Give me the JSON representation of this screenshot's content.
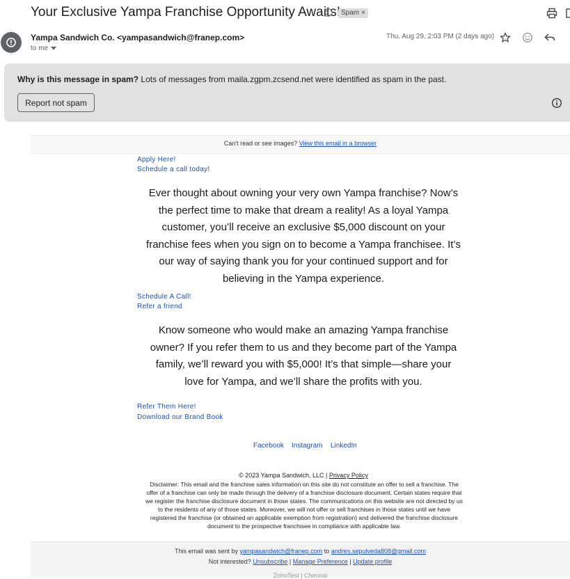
{
  "header": {
    "subject": "Your Exclusive Yampa Franchise Opportunity Awaits!",
    "label_chip": "Spam",
    "sender": "Yampa Sandwich Co. <yampasandwich@franep.com>",
    "recipient": "to me",
    "date": "Thu, Aug 29, 2:03 PM (2 days ago)"
  },
  "banner": {
    "question": "Why is this message in spam?",
    "reason": "Lots of messages from maila.zgpm.zcsend.net were identified as spam in the past.",
    "button": "Report not spam"
  },
  "email": {
    "topbar_text": "Can't read or see images?",
    "topbar_link": "View this email in a browser",
    "link_apply": "Apply Here!",
    "link_schedule_today": "Schedule a call today!",
    "paragraph1": "Ever thought about owning your very own Yampa franchise? Now’s the perfect time to make that dream a reality! As a loyal Yampa customer, you’ll receive an exclusive $5,000 discount on your franchise fees when you sign on to become a Yampa franchisee. It’s our way of saying thank you for your continued support and for believing in the Yampa experience.",
    "link_schedule_call": "Schedule A Call!",
    "link_refer_friend": "Refer a friend",
    "paragraph2": "Know someone who would make an amazing Yampa franchise owner? If you refer them to us and they become part of the Yampa family, we’ll reward you with $5,000! It’s that simple—share your love for Yampa, and we’ll share the profits with you.",
    "link_refer_them": "Refer Them Here!",
    "link_brand_book": "Download our Brand Book",
    "social": [
      "Facebook",
      "Instagram",
      "LinkedIn"
    ],
    "copyright": "© 2023 Yampa Sandwich, LLC |",
    "privacy": "Privacy Policy",
    "disclaimer": "Disclaimer: This email and the franchise sales information on this site do not constitute an offer to sell a franchise. The offer of a franchise can only be made through the delivery of a franchise disclosure document. Certain states require that we register the franchise disclosure document in those states. The communications on this website are not directed by us to the residents of any of those states. Moreover, we will not offer or sell franchises in those states until we have registered the franchise (or obtained an applicable exemption from registration) and delivered the franchise disclosure document to the prospective franchisee in compliance with applicable law."
  },
  "footer": {
    "sent_prefix": "This email was sent by",
    "sent_from": "yampasandwich@franep.com",
    "sent_to_word": "to",
    "sent_to": "andres.sepulveda808@gmail.com",
    "not_interested": "Not interested?",
    "unsubscribe": "Unsubscribe",
    "manage": "Manage Preference",
    "update": "Update profile",
    "sep": "|",
    "brand": "ZohoTest | Chennai"
  }
}
